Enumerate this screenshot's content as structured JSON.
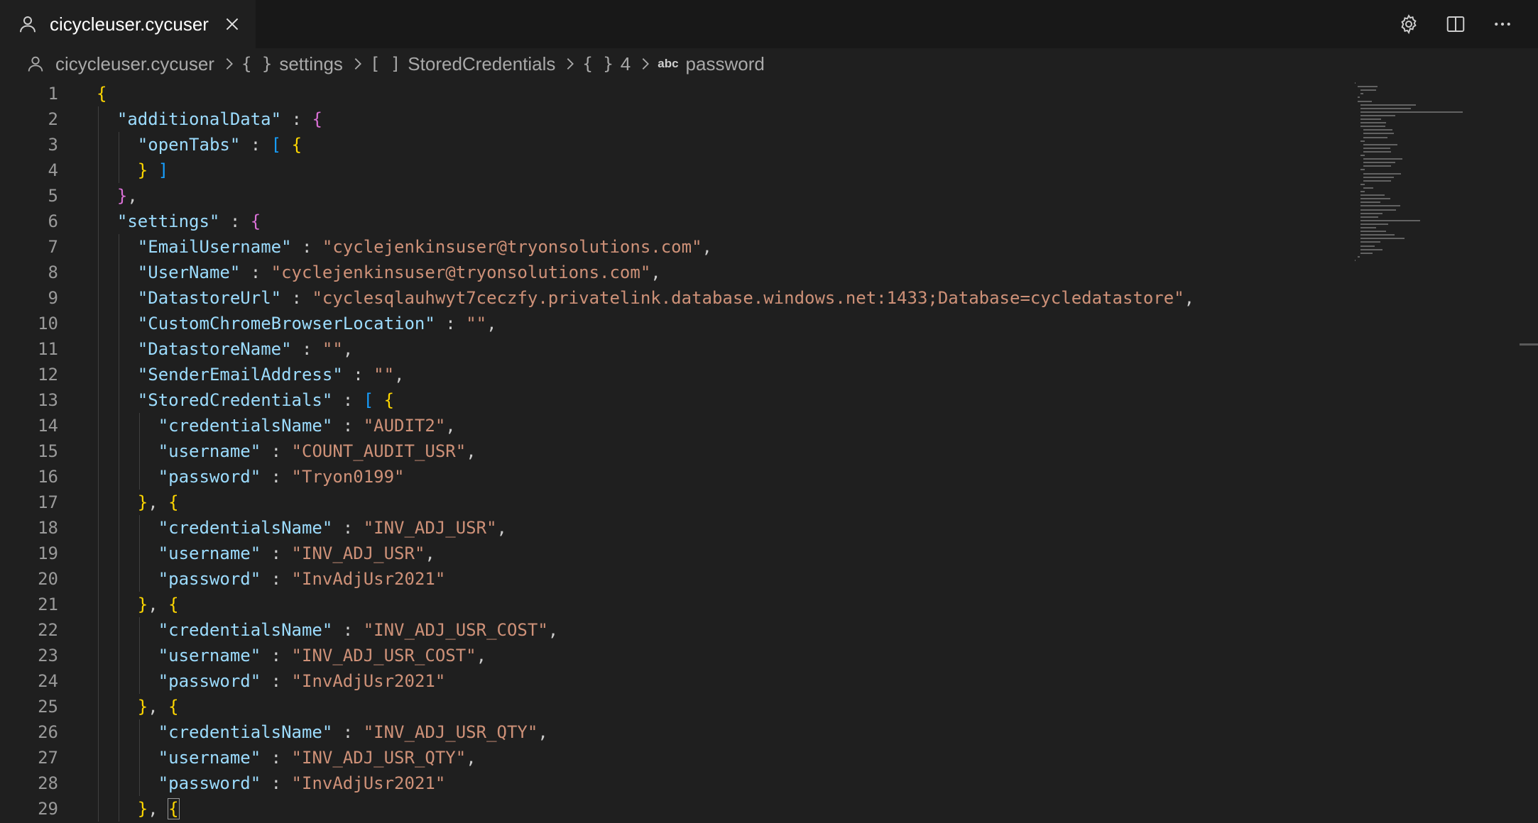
{
  "tab": {
    "label": "cicycleuser.cycuser",
    "icons": [
      "user-icon",
      "close-icon"
    ]
  },
  "toolbar": {
    "icons": [
      "gear-icon",
      "split-editor-icon",
      "more-icon"
    ]
  },
  "breadcrumb": {
    "items": [
      {
        "symbol": "",
        "label": "cicycleuser.cycuser"
      },
      {
        "symbol": "{ }",
        "label": "settings"
      },
      {
        "symbol": "[ ]",
        "label": "StoredCredentials"
      },
      {
        "symbol": "{ }",
        "label": "4"
      },
      {
        "symbol": "abc",
        "label": "password"
      }
    ]
  },
  "editor": {
    "lines": [
      {
        "n": "1",
        "indent": 0,
        "tokens": [
          [
            "b1",
            "{"
          ]
        ]
      },
      {
        "n": "2",
        "indent": 1,
        "tokens": [
          [
            "k",
            "\"additionalData\""
          ],
          [
            "p",
            " : "
          ],
          [
            "b2",
            "{"
          ]
        ]
      },
      {
        "n": "3",
        "indent": 2,
        "tokens": [
          [
            "k",
            "\"openTabs\""
          ],
          [
            "p",
            " : "
          ],
          [
            "b3",
            "["
          ],
          [
            "p",
            " "
          ],
          [
            "b1",
            "{"
          ]
        ]
      },
      {
        "n": "4",
        "indent": 2,
        "tokens": [
          [
            "b1",
            "}"
          ],
          [
            "p",
            " "
          ],
          [
            "b3",
            "]"
          ]
        ]
      },
      {
        "n": "5",
        "indent": 1,
        "tokens": [
          [
            "b2",
            "}"
          ],
          [
            "p",
            ","
          ]
        ]
      },
      {
        "n": "6",
        "indent": 1,
        "tokens": [
          [
            "k",
            "\"settings\""
          ],
          [
            "p",
            " : "
          ],
          [
            "b2",
            "{"
          ]
        ]
      },
      {
        "n": "7",
        "indent": 2,
        "tokens": [
          [
            "k",
            "\"EmailUsername\""
          ],
          [
            "p",
            " : "
          ],
          [
            "s",
            "\"cyclejenkinsuser@tryonsolutions.com\""
          ],
          [
            "p",
            ","
          ]
        ]
      },
      {
        "n": "8",
        "indent": 2,
        "tokens": [
          [
            "k",
            "\"UserName\""
          ],
          [
            "p",
            " : "
          ],
          [
            "s",
            "\"cyclejenkinsuser@tryonsolutions.com\""
          ],
          [
            "p",
            ","
          ]
        ]
      },
      {
        "n": "9",
        "indent": 2,
        "tokens": [
          [
            "k",
            "\"DatastoreUrl\""
          ],
          [
            "p",
            " : "
          ],
          [
            "s",
            "\"cyclesqlauhwyt7ceczfy.privatelink.database.windows.net:1433;Database=cycledatastore\""
          ],
          [
            "p",
            ","
          ]
        ]
      },
      {
        "n": "10",
        "indent": 2,
        "tokens": [
          [
            "k",
            "\"CustomChromeBrowserLocation\""
          ],
          [
            "p",
            " : "
          ],
          [
            "s",
            "\"\""
          ],
          [
            "p",
            ","
          ]
        ]
      },
      {
        "n": "11",
        "indent": 2,
        "tokens": [
          [
            "k",
            "\"DatastoreName\""
          ],
          [
            "p",
            " : "
          ],
          [
            "s",
            "\"\""
          ],
          [
            "p",
            ","
          ]
        ]
      },
      {
        "n": "12",
        "indent": 2,
        "tokens": [
          [
            "k",
            "\"SenderEmailAddress\""
          ],
          [
            "p",
            " : "
          ],
          [
            "s",
            "\"\""
          ],
          [
            "p",
            ","
          ]
        ]
      },
      {
        "n": "13",
        "indent": 2,
        "tokens": [
          [
            "k",
            "\"StoredCredentials\""
          ],
          [
            "p",
            " : "
          ],
          [
            "b3",
            "["
          ],
          [
            "p",
            " "
          ],
          [
            "b1",
            "{"
          ]
        ]
      },
      {
        "n": "14",
        "indent": 3,
        "tokens": [
          [
            "k",
            "\"credentialsName\""
          ],
          [
            "p",
            " : "
          ],
          [
            "s",
            "\"AUDIT2\""
          ],
          [
            "p",
            ","
          ]
        ]
      },
      {
        "n": "15",
        "indent": 3,
        "tokens": [
          [
            "k",
            "\"username\""
          ],
          [
            "p",
            " : "
          ],
          [
            "s",
            "\"COUNT_AUDIT_USR\""
          ],
          [
            "p",
            ","
          ]
        ]
      },
      {
        "n": "16",
        "indent": 3,
        "tokens": [
          [
            "k",
            "\"password\""
          ],
          [
            "p",
            " : "
          ],
          [
            "s",
            "\"Tryon0199\""
          ]
        ]
      },
      {
        "n": "17",
        "indent": 2,
        "tokens": [
          [
            "b1",
            "}"
          ],
          [
            "p",
            ", "
          ],
          [
            "b1",
            "{"
          ]
        ]
      },
      {
        "n": "18",
        "indent": 3,
        "tokens": [
          [
            "k",
            "\"credentialsName\""
          ],
          [
            "p",
            " : "
          ],
          [
            "s",
            "\"INV_ADJ_USR\""
          ],
          [
            "p",
            ","
          ]
        ]
      },
      {
        "n": "19",
        "indent": 3,
        "tokens": [
          [
            "k",
            "\"username\""
          ],
          [
            "p",
            " : "
          ],
          [
            "s",
            "\"INV_ADJ_USR\""
          ],
          [
            "p",
            ","
          ]
        ]
      },
      {
        "n": "20",
        "indent": 3,
        "tokens": [
          [
            "k",
            "\"password\""
          ],
          [
            "p",
            " : "
          ],
          [
            "s",
            "\"InvAdjUsr2021\""
          ]
        ]
      },
      {
        "n": "21",
        "indent": 2,
        "tokens": [
          [
            "b1",
            "}"
          ],
          [
            "p",
            ", "
          ],
          [
            "b1",
            "{"
          ]
        ]
      },
      {
        "n": "22",
        "indent": 3,
        "tokens": [
          [
            "k",
            "\"credentialsName\""
          ],
          [
            "p",
            " : "
          ],
          [
            "s",
            "\"INV_ADJ_USR_COST\""
          ],
          [
            "p",
            ","
          ]
        ]
      },
      {
        "n": "23",
        "indent": 3,
        "tokens": [
          [
            "k",
            "\"username\""
          ],
          [
            "p",
            " : "
          ],
          [
            "s",
            "\"INV_ADJ_USR_COST\""
          ],
          [
            "p",
            ","
          ]
        ]
      },
      {
        "n": "24",
        "indent": 3,
        "tokens": [
          [
            "k",
            "\"password\""
          ],
          [
            "p",
            " : "
          ],
          [
            "s",
            "\"InvAdjUsr2021\""
          ]
        ]
      },
      {
        "n": "25",
        "indent": 2,
        "tokens": [
          [
            "b1",
            "}"
          ],
          [
            "p",
            ", "
          ],
          [
            "b1",
            "{"
          ]
        ]
      },
      {
        "n": "26",
        "indent": 3,
        "tokens": [
          [
            "k",
            "\"credentialsName\""
          ],
          [
            "p",
            " : "
          ],
          [
            "s",
            "\"INV_ADJ_USR_QTY\""
          ],
          [
            "p",
            ","
          ]
        ]
      },
      {
        "n": "27",
        "indent": 3,
        "tokens": [
          [
            "k",
            "\"username\""
          ],
          [
            "p",
            " : "
          ],
          [
            "s",
            "\"INV_ADJ_USR_QTY\""
          ],
          [
            "p",
            ","
          ]
        ]
      },
      {
        "n": "28",
        "indent": 3,
        "tokens": [
          [
            "k",
            "\"password\""
          ],
          [
            "p",
            " : "
          ],
          [
            "s",
            "\"InvAdjUsr2021\""
          ]
        ]
      },
      {
        "n": "29",
        "indent": 2,
        "tokens": [
          [
            "b1",
            "}"
          ],
          [
            "p",
            ", "
          ],
          [
            "b1",
            "{"
          ]
        ]
      }
    ],
    "colors": {
      "key": "#9cdcfe",
      "string": "#ce9178",
      "punct": "#cccccc",
      "bracket1": "#ffd700",
      "bracket2": "#da70d6",
      "bracket3": "#179fff"
    }
  }
}
